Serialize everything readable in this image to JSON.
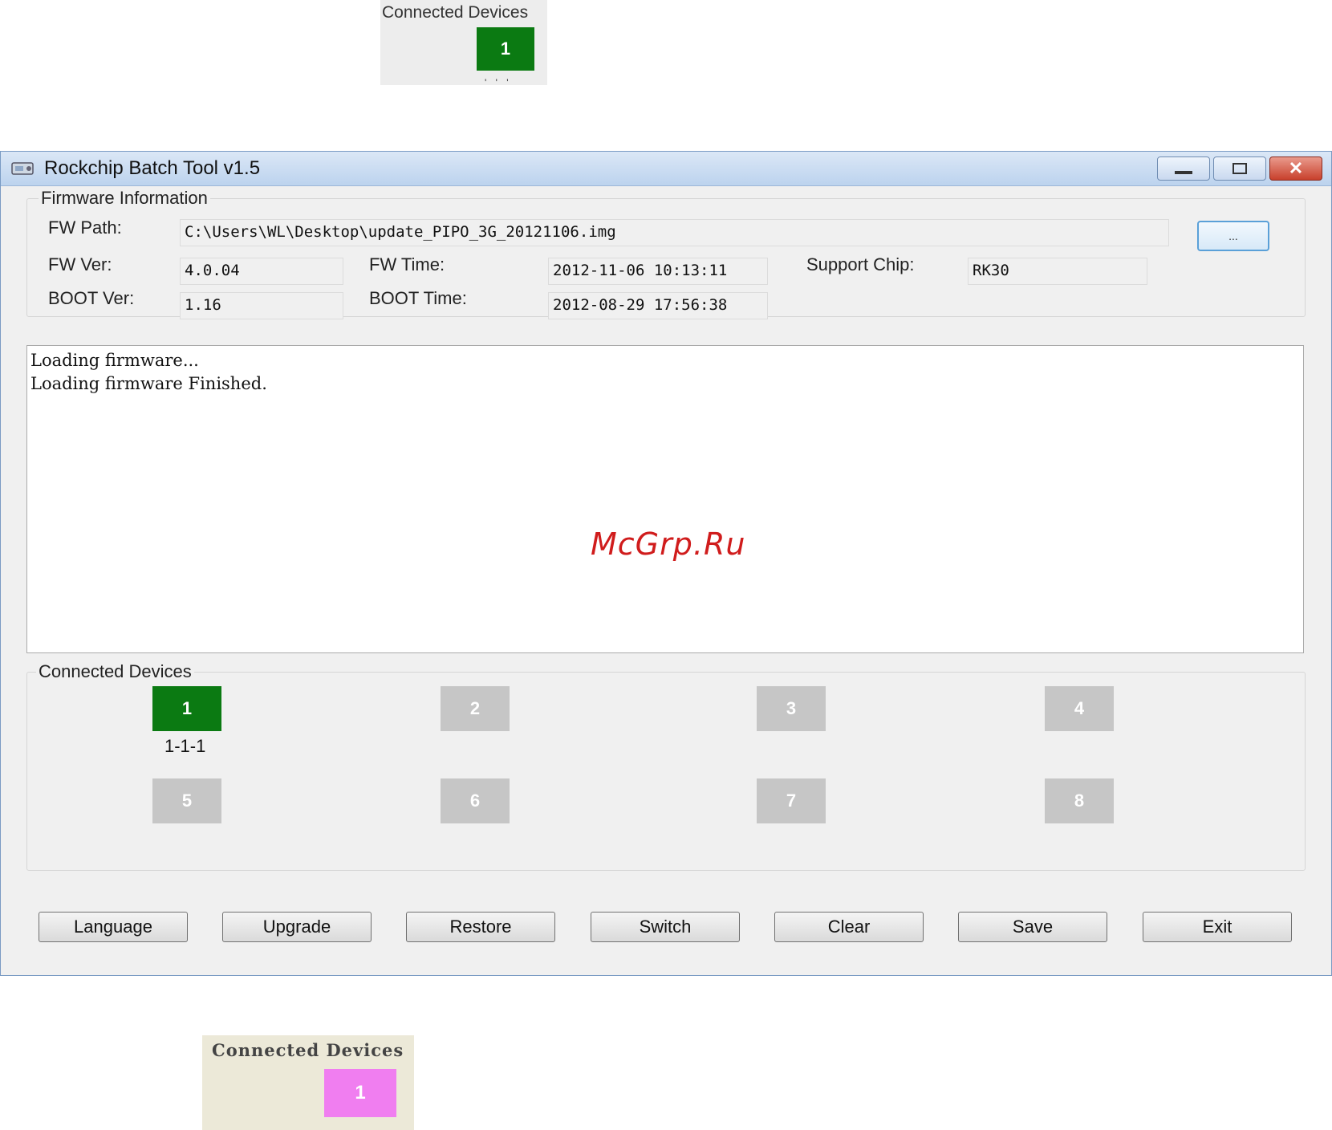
{
  "top_snippet": {
    "label": "Connected Devices",
    "device": "1",
    "device_status_color": "#0b7a12"
  },
  "window": {
    "title": "Rockchip Batch Tool v1.5",
    "controls": {
      "minimize": "minimize-icon",
      "maximize": "maximize-icon",
      "close": "✕"
    }
  },
  "firmware": {
    "group_label": "Firmware Information",
    "fw_path_label": "FW Path:",
    "fw_path": "C:\\Users\\WL\\Desktop\\update_PIPO_3G_20121106.img",
    "browse_label": "...",
    "fw_ver_label": "FW Ver:",
    "fw_ver": "4.0.04",
    "fw_time_label": "FW Time:",
    "fw_time": "2012-11-06 10:13:11",
    "support_chip_label": "Support Chip:",
    "support_chip": "RK30",
    "boot_ver_label": "BOOT Ver:",
    "boot_ver": "1.16",
    "boot_time_label": "BOOT Time:",
    "boot_time": "2012-08-29 17:56:38"
  },
  "log": {
    "lines": [
      "Loading firmware...",
      "Loading firmware Finished."
    ]
  },
  "watermark": "McGrp.Ru",
  "devices": {
    "group_label": "Connected Devices",
    "slots": [
      {
        "number": "1",
        "status": "connected",
        "address": "1-1-1"
      },
      {
        "number": "2",
        "status": "empty"
      },
      {
        "number": "3",
        "status": "empty"
      },
      {
        "number": "4",
        "status": "empty"
      },
      {
        "number": "5",
        "status": "empty"
      },
      {
        "number": "6",
        "status": "empty"
      },
      {
        "number": "7",
        "status": "empty"
      },
      {
        "number": "8",
        "status": "empty"
      }
    ],
    "colors": {
      "connected": "#0b7a12",
      "empty": "#c6c6c6"
    }
  },
  "buttons": {
    "language": "Language",
    "upgrade": "Upgrade",
    "restore": "Restore",
    "switch": "Switch",
    "clear": "Clear",
    "save": "Save",
    "exit": "Exit"
  },
  "bottom_snippet": {
    "label": "Connected Devices",
    "device": "1",
    "device_status_color": "#f07ef0"
  }
}
